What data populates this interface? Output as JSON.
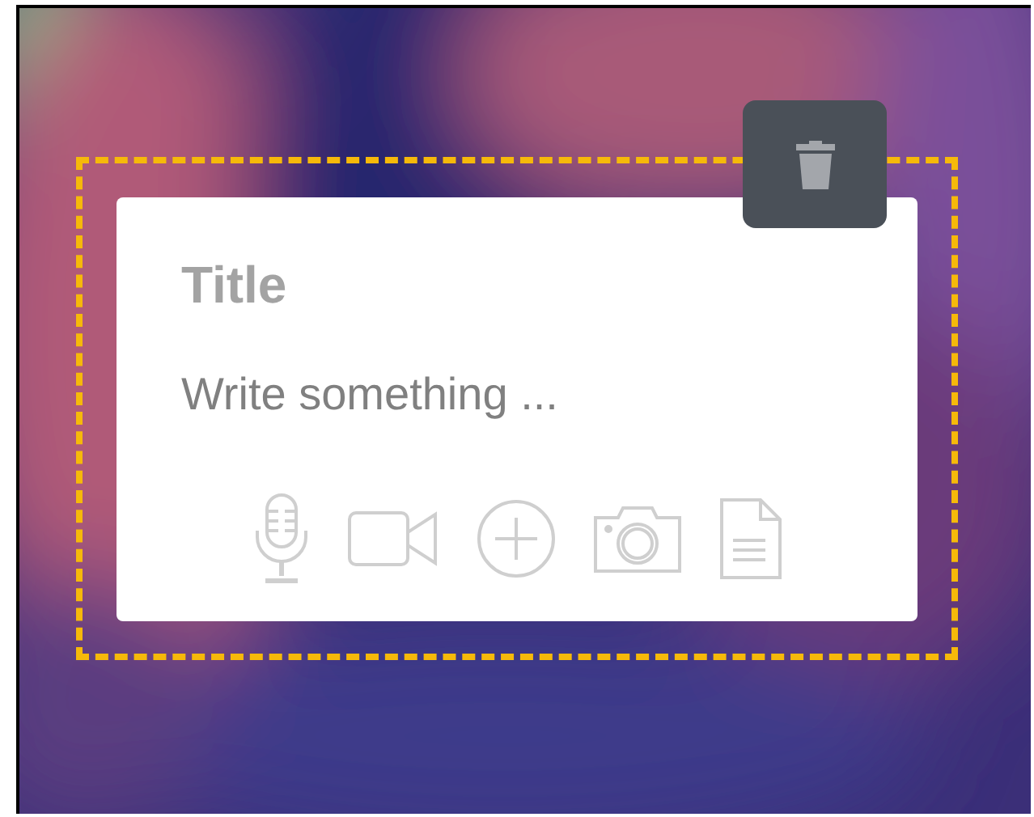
{
  "delete_button": {
    "kind": "trash"
  },
  "note": {
    "title": {
      "placeholder": "Title"
    },
    "body": {
      "placeholder": "Write something ..."
    }
  }
}
